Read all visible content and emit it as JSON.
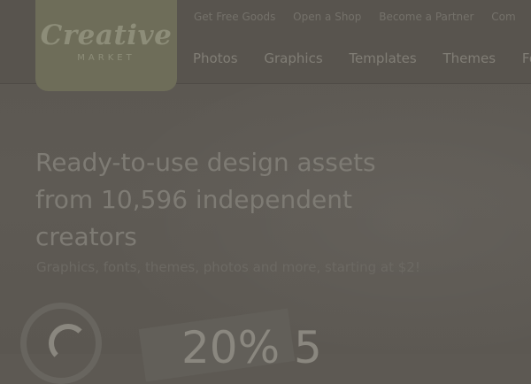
{
  "logo": {
    "word": "Creative",
    "sub": "MARKET"
  },
  "top_nav": [
    "Get Free Goods",
    "Open a Shop",
    "Become a Partner",
    "Com"
  ],
  "main_nav": [
    "Photos",
    "Graphics",
    "Templates",
    "Themes",
    "Fon"
  ],
  "hero": {
    "headline": "Ready-to-use design assets from 10,596 independent creators",
    "subline": "Graphics, fonts, themes, photos and more, starting at $2!"
  },
  "promo": {
    "text": "20% 5"
  }
}
